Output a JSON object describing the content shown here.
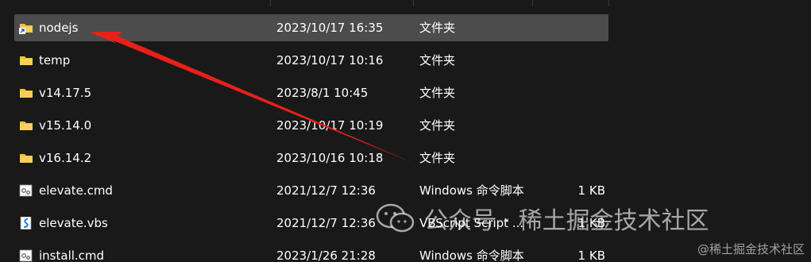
{
  "files": [
    {
      "name": "nodejs",
      "date": "2023/10/17 16:35",
      "type": "文件夹",
      "size": "",
      "icon": "folder-shortcut-icon",
      "selected": true
    },
    {
      "name": "temp",
      "date": "2023/10/17 10:16",
      "type": "文件夹",
      "size": "",
      "icon": "folder-icon",
      "selected": false
    },
    {
      "name": "v14.17.5",
      "date": "2023/8/1 10:45",
      "type": "文件夹",
      "size": "",
      "icon": "folder-icon",
      "selected": false
    },
    {
      "name": "v15.14.0",
      "date": "2023/10/17 10:19",
      "type": "文件夹",
      "size": "",
      "icon": "folder-icon",
      "selected": false
    },
    {
      "name": "v16.14.2",
      "date": "2023/10/16 10:18",
      "type": "文件夹",
      "size": "",
      "icon": "folder-icon",
      "selected": false
    },
    {
      "name": "elevate.cmd",
      "date": "2021/12/7 12:36",
      "type": "Windows 命令脚本",
      "size": "1 KB",
      "icon": "cmd-file-icon",
      "selected": false
    },
    {
      "name": "elevate.vbs",
      "date": "2021/12/7 12:36",
      "type": "VBScript Script ...",
      "size": "1 KB",
      "icon": "vbs-file-icon",
      "selected": false
    },
    {
      "name": "install.cmd",
      "date": "2023/1/26 21:28",
      "type": "Windows 命令脚本",
      "size": "1 KB",
      "icon": "cmd-file-icon",
      "selected": false
    }
  ],
  "watermark": {
    "text": "公众号 · 稀土掘金技术社区",
    "corner_text": "@稀土掘金技术社区"
  },
  "colors": {
    "background": "#191919",
    "selected_row": "#4c4c4c",
    "folder": "#f3c13a",
    "arrow": "#e8201a"
  }
}
